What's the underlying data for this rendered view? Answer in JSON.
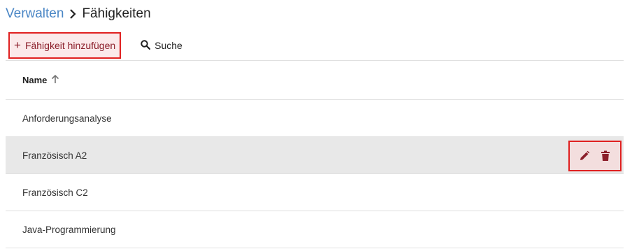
{
  "breadcrumb": {
    "parent": "Verwalten",
    "separator_icon": "chevron-right-icon",
    "current": "Fähigkeiten"
  },
  "toolbar": {
    "add_icon": "plus-icon",
    "add_label": "Fähigkeit hinzufügen",
    "search_icon": "search-icon",
    "search_label": "Suche"
  },
  "table": {
    "column_name": "Name",
    "sort_icon": "arrow-up-icon",
    "rows": [
      {
        "name": "Anforderungsanalyse"
      },
      {
        "name": "Französisch A2"
      },
      {
        "name": "Französisch C2"
      },
      {
        "name": "Java-Programmierung"
      }
    ],
    "selected_row_index": 1,
    "row_actions": {
      "edit_icon": "pencil-icon",
      "delete_icon": "trash-icon"
    }
  },
  "colors": {
    "link": "#4a86c5",
    "accent": "#8b1e2a",
    "highlight_border": "#e02020",
    "selected_row": "#e8e8e8"
  }
}
